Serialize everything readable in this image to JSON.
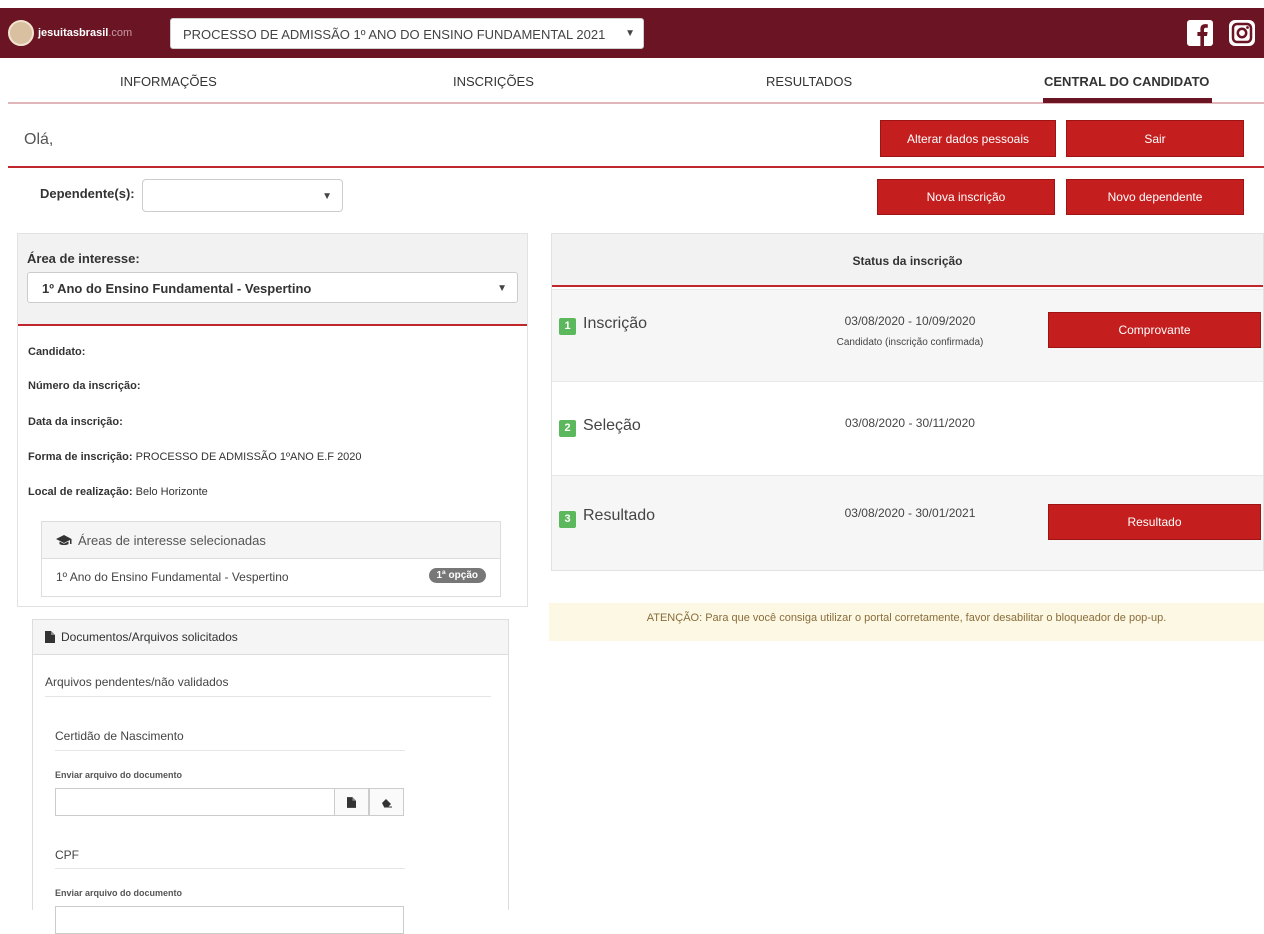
{
  "brand": {
    "name": "jesuitasbrasil",
    "domain": ".com",
    "color": "#6b1424",
    "accent": "#c41e1e"
  },
  "header": {
    "process_select": "PROCESSO DE ADMISSÃO 1º ANO DO ENSINO FUNDAMENTAL 2021",
    "social": [
      "facebook-icon",
      "instagram-icon"
    ]
  },
  "nav": {
    "items": [
      {
        "label": "INFORMAÇÕES"
      },
      {
        "label": "INSCRIÇÕES"
      },
      {
        "label": "RESULTADOS"
      },
      {
        "label": "CENTRAL DO CANDIDATO",
        "active": true
      }
    ]
  },
  "greeting": "Olá,",
  "actions": {
    "alterar": "Alterar dados pessoais",
    "sair": "Sair",
    "nova_inscricao": "Nova inscrição",
    "novo_dependente": "Novo dependente"
  },
  "dependentes": {
    "label": "Dependente(s):",
    "value": ""
  },
  "area": {
    "label": "Área de interesse:",
    "selected": "1º Ano do Ensino Fundamental - Vespertino"
  },
  "candidate": {
    "candidato_label": "Candidato:",
    "candidato_value": "",
    "numero_label": "Número da inscrição:",
    "numero_value": "",
    "data_label": "Data da inscrição:",
    "data_value": "",
    "forma_label": "Forma de inscrição:",
    "forma_value": "PROCESSO DE ADMISSÃO 1ºANO E.F 2020",
    "local_label": "Local de realização:",
    "local_value": "Belo Horizonte"
  },
  "areas_selecionadas": {
    "title": "Áreas de interesse selecionadas",
    "items": [
      {
        "label": "1º Ano do Ensino Fundamental - Vespertino",
        "badge": "1ª opção"
      }
    ]
  },
  "status": {
    "title": "Status da inscrição",
    "steps": [
      {
        "num": "1",
        "title": "Inscrição",
        "dates": "03/08/2020 - 10/09/2020",
        "status": "Candidato (inscrição confirmada)",
        "button": "Comprovante"
      },
      {
        "num": "2",
        "title": "Seleção",
        "dates": "03/08/2020 - 30/11/2020"
      },
      {
        "num": "3",
        "title": "Resultado",
        "dates": "03/08/2020 - 30/01/2021",
        "button": "Resultado"
      }
    ]
  },
  "alert": "ATENÇÃO: Para que você consiga utilizar o portal corretamente, favor desabilitar o bloqueador de pop-up.",
  "documents": {
    "title": "Documentos/Arquivos solicitados",
    "subtitle": "Arquivos pendentes/não validados",
    "items": [
      {
        "name": "Certidão de Nascimento",
        "upload_label": "Enviar arquivo do documento"
      },
      {
        "name": "CPF",
        "upload_label": "Enviar arquivo do documento"
      }
    ]
  }
}
